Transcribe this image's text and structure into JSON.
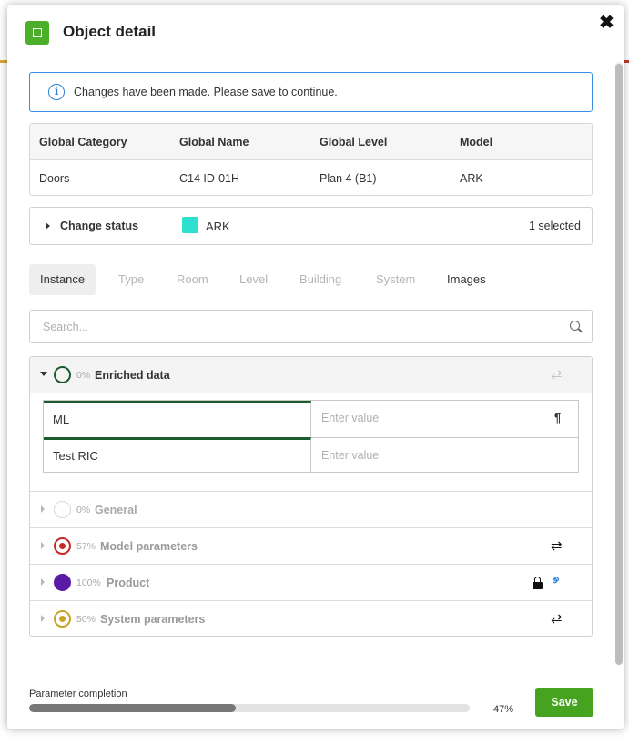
{
  "modal": {
    "title": "Object detail",
    "close_label": "✖"
  },
  "alert": {
    "icon": "info-icon",
    "text": "Changes have been made. Please save to continue."
  },
  "info_table": {
    "headers": [
      "Global Category",
      "Global Name",
      "Global Level",
      "Model"
    ],
    "values": [
      "Doors",
      "C14 ID-01H",
      "Plan 4 (B1)",
      "ARK"
    ]
  },
  "change_status": {
    "label": "Change status",
    "value": "ARK",
    "swatch_color": "#2ee0cf",
    "selected": "1 selected"
  },
  "tabs": [
    {
      "label": "Instance",
      "state": "active"
    },
    {
      "label": "Type",
      "state": "disabled"
    },
    {
      "label": "Room",
      "state": "disabled"
    },
    {
      "label": "Level",
      "state": "disabled"
    },
    {
      "label": "Building",
      "state": "disabled"
    },
    {
      "label": "System",
      "state": "disabled"
    },
    {
      "label": "Images",
      "state": "enabled"
    }
  ],
  "search": {
    "placeholder": "Search...",
    "value": ""
  },
  "sections": [
    {
      "percent": "0%",
      "name": "Enriched data",
      "expanded": true,
      "ring_color": "#1c5a2f",
      "icons": [
        "sync-icon"
      ]
    },
    {
      "percent": "0%",
      "name": "General",
      "expanded": false,
      "ring_color": "#d8d8d8",
      "icons": []
    },
    {
      "percent": "57%",
      "name": "Model parameters",
      "expanded": false,
      "ring_color": "#c62828",
      "icons": [
        "sync-icon"
      ]
    },
    {
      "percent": "100%",
      "name": "Product",
      "expanded": false,
      "ring_color": "#5b1aa6",
      "icons": [
        "lock-icon",
        "link-icon"
      ]
    },
    {
      "percent": "50%",
      "name": "System parameters",
      "expanded": false,
      "ring_color": "#c9a227",
      "icons": [
        "sync-icon"
      ]
    }
  ],
  "enriched_fields": [
    {
      "label": "ML",
      "placeholder": "Enter value",
      "value": ""
    },
    {
      "label": "Test RIC",
      "placeholder": "Enter value",
      "value": ""
    }
  ],
  "footer": {
    "completion_label": "Parameter completion",
    "completion_percent": "47%",
    "completion_fraction": 0.47,
    "save_label": "Save"
  },
  "colors": {
    "primary_green": "#46a31f",
    "alert_blue": "#3a8de0",
    "link_blue": "#2b7fd6"
  }
}
